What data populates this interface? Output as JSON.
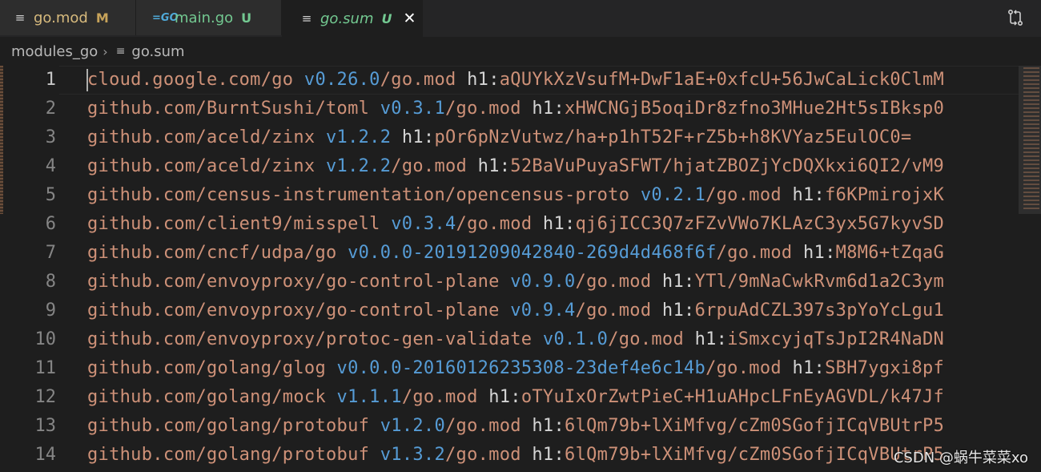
{
  "tabs": [
    {
      "label": "go.mod",
      "status": "M",
      "icon": "lines-icon",
      "status_color": "#c7a35a",
      "label_color": "#d7ba7d"
    },
    {
      "label": "main.go",
      "status": "U",
      "icon": "go-icon",
      "status_color": "#73c991",
      "label_color": "#73c991"
    },
    {
      "label": "go.sum",
      "status": "U",
      "icon": "lines-icon",
      "status_color": "#73c991",
      "label_color": "#73c991",
      "active": true,
      "close": "✕"
    }
  ],
  "breadcrumb": {
    "folder": "modules_go",
    "file": "go.sum"
  },
  "lines": [
    {
      "n": "1",
      "module": "cloud.google.com/go",
      "version": "v0.26.0",
      "suffix": "/go.mod",
      "hkey": "h1:",
      "hash": "aQUYkXzVsufM+DwF1aE+0xfcU+56JwCaLick0ClmM"
    },
    {
      "n": "2",
      "module": "github.com/BurntSushi/toml",
      "version": "v0.3.1",
      "suffix": "/go.mod",
      "hkey": "h1:",
      "hash": "xHWCNGjB5oqiDr8zfno3MHue2Ht5sIBksp0"
    },
    {
      "n": "3",
      "module": "github.com/aceld/zinx",
      "version": "v1.2.2",
      "suffix": "",
      "hkey": "h1:",
      "hash": "pOr6pNzVutwz/ha+p1hT52F+rZ5b+h8KVYaz5EulOC0="
    },
    {
      "n": "4",
      "module": "github.com/aceld/zinx",
      "version": "v1.2.2",
      "suffix": "/go.mod",
      "hkey": "h1:",
      "hash": "52BaVuPuyaSFWT/hjatZBOZjYcDQXkxi6QI2/vM9"
    },
    {
      "n": "5",
      "module": "github.com/census-instrumentation/opencensus-proto",
      "version": "v0.2.1",
      "suffix": "/go.mod",
      "hkey": "h1:",
      "hash": "f6KPmirojxK"
    },
    {
      "n": "6",
      "module": "github.com/client9/misspell",
      "version": "v0.3.4",
      "suffix": "/go.mod",
      "hkey": "h1:",
      "hash": "qj6jICC3Q7zFZvVWo7KLAzC3yx5G7kyvSD"
    },
    {
      "n": "7",
      "module": "github.com/cncf/udpa/go",
      "version": "v0.0.0-20191209042840-269d4d468f6f",
      "suffix": "/go.mod",
      "hkey": "h1:",
      "hash": "M8M6+tZqaG"
    },
    {
      "n": "8",
      "module": "github.com/envoyproxy/go-control-plane",
      "version": "v0.9.0",
      "suffix": "/go.mod",
      "hkey": "h1:",
      "hash": "YTl/9mNaCwkRvm6d1a2C3ym"
    },
    {
      "n": "9",
      "module": "github.com/envoyproxy/go-control-plane",
      "version": "v0.9.4",
      "suffix": "/go.mod",
      "hkey": "h1:",
      "hash": "6rpuAdCZL397s3pYoYcLgu1"
    },
    {
      "n": "10",
      "module": "github.com/envoyproxy/protoc-gen-validate",
      "version": "v0.1.0",
      "suffix": "/go.mod",
      "hkey": "h1:",
      "hash": "iSmxcyjqTsJpI2R4NaDN"
    },
    {
      "n": "11",
      "module": "github.com/golang/glog",
      "version": "v0.0.0-20160126235308-23def4e6c14b",
      "suffix": "/go.mod",
      "hkey": "h1:",
      "hash": "SBH7ygxi8pf"
    },
    {
      "n": "12",
      "module": "github.com/golang/mock",
      "version": "v1.1.1",
      "suffix": "/go.mod",
      "hkey": "h1:",
      "hash": "oTYuIxOrZwtPieC+H1uAHpcLFnEyAGVDL/k47Jf"
    },
    {
      "n": "13",
      "module": "github.com/golang/protobuf",
      "version": "v1.2.0",
      "suffix": "/go.mod",
      "hkey": "h1:",
      "hash": "6lQm79b+lXiMfvg/cZm0SGofjICqVBUtrP5"
    },
    {
      "n": "14",
      "module": "github.com/golang/protobuf",
      "version": "v1.3.2",
      "suffix": "/go.mod",
      "hkey": "h1:",
      "hash": "6lQm79b+lXiMfvg/cZm0SGofjICqVBUtrP5"
    }
  ],
  "watermark": "CSDN @蜗牛菜菜xo"
}
